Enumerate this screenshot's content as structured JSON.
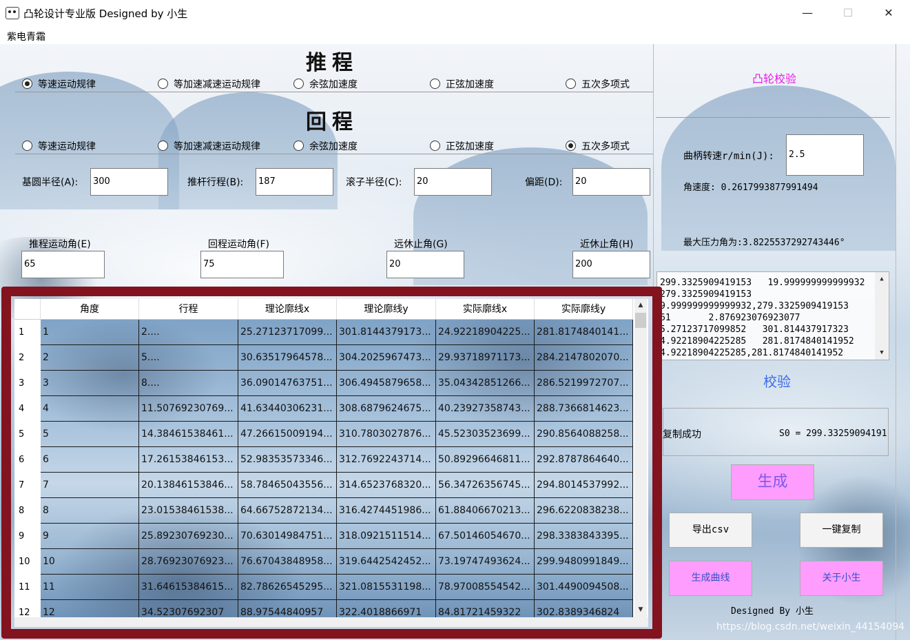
{
  "window": {
    "title": "凸轮设计专业版  Designed by 小生",
    "minimize": "—",
    "maximize": "☐",
    "close": "✕"
  },
  "menu": {
    "items": [
      "紫电青霜"
    ]
  },
  "push": {
    "title": "推程",
    "options": [
      "等速运动规律",
      "等加速减速运动规律",
      "余弦加速度",
      "正弦加速度",
      "五次多项式"
    ],
    "selected_index": 0
  },
  "return": {
    "title": "回程",
    "options": [
      "等速运动规律",
      "等加速减速运动规律",
      "余弦加速度",
      "正弦加速度",
      "五次多项式"
    ],
    "selected_index": 4
  },
  "params": {
    "base_radius": {
      "label": "基圆半径(A):",
      "value": "300"
    },
    "push_stroke": {
      "label": "推杆行程(B):",
      "value": "187"
    },
    "roller_radius": {
      "label": "滚子半径(C):",
      "value": "20"
    },
    "offset": {
      "label": "偏距(D):",
      "value": "20"
    },
    "push_angle": {
      "label": "推程运动角(E)",
      "value": "65"
    },
    "return_angle": {
      "label": "回程运动角(F)",
      "value": "75"
    },
    "far_rest_angle": {
      "label": "远休止角(G)",
      "value": "20"
    },
    "near_rest_angle": {
      "label": "近休止角(H)",
      "value": "200"
    }
  },
  "right": {
    "check_title": "凸轮校验",
    "crank_speed_label": "曲柄转速r/min(J):",
    "crank_speed_value": "2.5",
    "angular_velocity": "角速度: 0.2617993877991494",
    "max_pressure_angle": "最大压力角为:3.8225537292743446°",
    "log_lines": [
      "299.3325909419153   19.999999999999932",
      "279.3325909419153",
      "9.999999999999932,279.3325909419153",
      "61       2.876923076923077",
      "5.27123717099852   301.814437917323",
      "4.92218904225285   281.8174840141952",
      "4.92218904225285,281.8174840141952"
    ],
    "verify_label": "校验",
    "copy_status": "复制成功",
    "s0_text": "S0 = 299.33259094191",
    "generate_label": "生成",
    "export_csv_label": "导出csv",
    "copy_all_label": "一键复制",
    "gen_curve_label": "生成曲线",
    "about_label": "关于小生",
    "footer": "Designed By 小生"
  },
  "table": {
    "columns": [
      "角度",
      "行程",
      "理论廓线x",
      "理论廓线y",
      "实际廓线x",
      "实际廓线y"
    ],
    "rows": [
      {
        "n": "1",
        "cells": [
          "1",
          "2....",
          "25.27123717099...",
          "301.8144379173...",
          "24.92218904225...",
          "281.8174840141..."
        ]
      },
      {
        "n": "2",
        "cells": [
          "2",
          "5....",
          "30.63517964578...",
          "304.2025967473...",
          "29.93718971173...",
          "284.2147802070..."
        ]
      },
      {
        "n": "3",
        "cells": [
          "3",
          "8....",
          "36.09014763751...",
          "306.4945879658...",
          "35.04342851266...",
          "286.5219972707..."
        ]
      },
      {
        "n": "4",
        "cells": [
          "4",
          "11.50769230769...",
          "41.63440306231...",
          "308.6879624675...",
          "40.23927358743...",
          "288.7366814623..."
        ]
      },
      {
        "n": "5",
        "cells": [
          "5",
          "14.38461538461...",
          "47.26615009194...",
          "310.7803027876...",
          "45.52303523699...",
          "290.8564088258..."
        ]
      },
      {
        "n": "6",
        "cells": [
          "6",
          "17.26153846153...",
          "52.98353573346...",
          "312.7692243714...",
          "50.89296646811...",
          "292.8787864640..."
        ]
      },
      {
        "n": "7",
        "cells": [
          "7",
          "20.13846153846...",
          "58.78465043556...",
          "314.6523768320...",
          "56.34726356745...",
          "294.8014537992..."
        ]
      },
      {
        "n": "8",
        "cells": [
          "8",
          "23.01538461538...",
          "64.66752872134...",
          "316.4274451986...",
          "61.88406670213...",
          "296.6220838238..."
        ]
      },
      {
        "n": "9",
        "cells": [
          "9",
          "25.89230769230...",
          "70.63014984751...",
          "318.0921511514...",
          "67.50146054670...",
          "298.3383843395..."
        ]
      },
      {
        "n": "10",
        "cells": [
          "10",
          "28.76923076923...",
          "76.67043848958...",
          "319.6442542452...",
          "73.19747493624...",
          "299.9480991849..."
        ]
      },
      {
        "n": "11",
        "cells": [
          "11",
          "31.64615384615...",
          "82.78626545295...",
          "321.0815531198...",
          "78.97008554542...",
          "301.4490094508..."
        ]
      },
      {
        "n": "12",
        "cells": [
          "12",
          "34.52307692307",
          "88.97544840957",
          "322.4018866971",
          "84.81721459322",
          "302.8389346824"
        ]
      }
    ]
  },
  "watermark": "https://blog.csdn.net/weixin_44154094"
}
